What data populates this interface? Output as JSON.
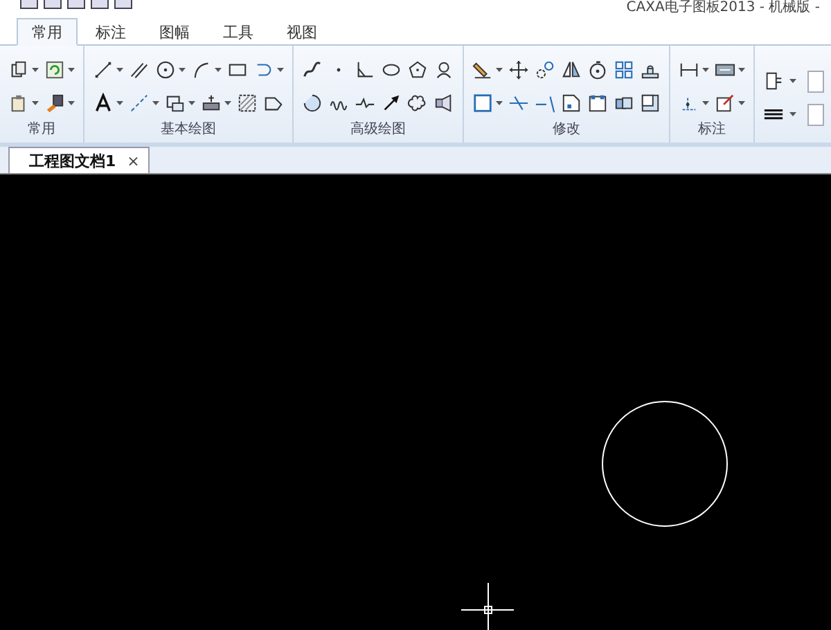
{
  "window": {
    "title": "CAXA电子图板2013 - 机械版 -"
  },
  "tabs": [
    {
      "label": "常用",
      "selected": true
    },
    {
      "label": "标注",
      "selected": false
    },
    {
      "label": "图幅",
      "selected": false
    },
    {
      "label": "工具",
      "selected": false
    },
    {
      "label": "视图",
      "selected": false
    }
  ],
  "ribbon": {
    "groups": [
      {
        "label": "常用"
      },
      {
        "label": "基本绘图"
      },
      {
        "label": "高级绘图"
      },
      {
        "label": "修改"
      },
      {
        "label": "标注"
      }
    ]
  },
  "document_tabs": [
    {
      "label": "工程图文档1",
      "selected": true,
      "close": "×"
    }
  ]
}
